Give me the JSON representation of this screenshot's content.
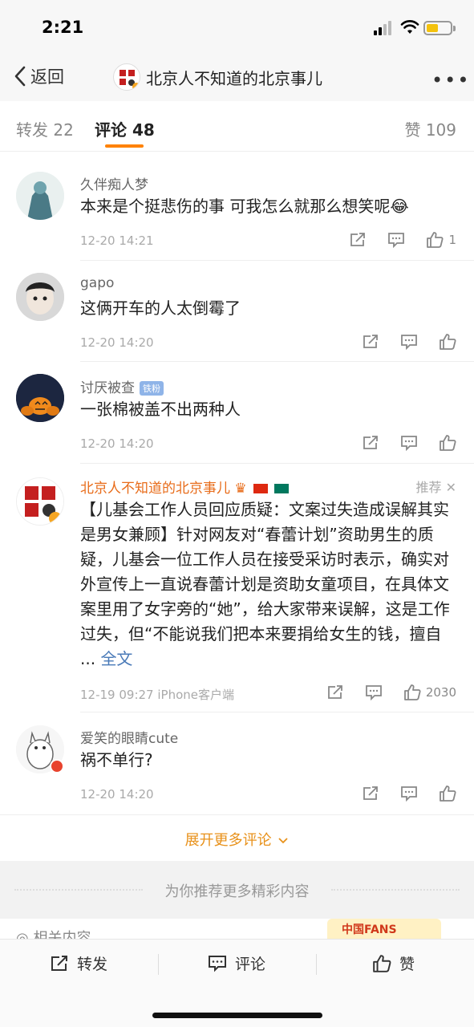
{
  "status_bar": {
    "time": "2:21"
  },
  "nav": {
    "back_label": "返回",
    "title": "北京人不知道的北京事儿"
  },
  "tabs": {
    "repost_label": "转发",
    "repost_count": "22",
    "comment_label": "评论",
    "comment_count": "48",
    "like_label": "赞",
    "like_count": "109"
  },
  "comments": [
    {
      "name": "久伴痴人梦",
      "text": "本来是个挺悲伤的事 可我怎么就那么想笑呢",
      "emoji": "😂",
      "time": "12-20 14:21",
      "likes": "1"
    },
    {
      "name": "gapo",
      "text": "这俩开车的人太倒霉了",
      "time": "12-20 14:20",
      "likes": ""
    },
    {
      "name": "讨厌被查",
      "badge": "铁粉",
      "text": "一张棉被盖不出两种人",
      "time": "12-20 14:20",
      "likes": ""
    },
    {
      "name": "北京人不知道的北京事儿",
      "reco_label": "推荐",
      "text": "【儿基会工作人员回应质疑：文案过失造成误解其实是男女兼顾】针对网友对“春蕾计划”资助男生的质疑，儿基会一位工作人员在接受采访时表示，确实对外宣传上一直说春蕾计划是资助女童项目，在具体文案里用了女字旁的“她”，给大家带来误解，这是工作过失，但“不能说我们把本来要捐给女生的钱，擅自 ...",
      "more_label": "全文",
      "time": "12-19 09:27 iPhone客户端",
      "likes": "2030"
    },
    {
      "name": "爱笑的眼睛cute",
      "text": "祸不单行?",
      "time": "12-20 14:20",
      "likes": ""
    }
  ],
  "expand_label": "展开更多评论",
  "recommend_label": "为你推荐更多精彩内容",
  "related_label": "相关内容",
  "fans_badge_text": "中国FANS",
  "bottom_bar": {
    "repost": "转发",
    "comment": "评论",
    "like": "赞"
  },
  "colors": {
    "accent": "#ff8200",
    "name_orange": "#e86c1a",
    "link": "#4a7ab8"
  }
}
